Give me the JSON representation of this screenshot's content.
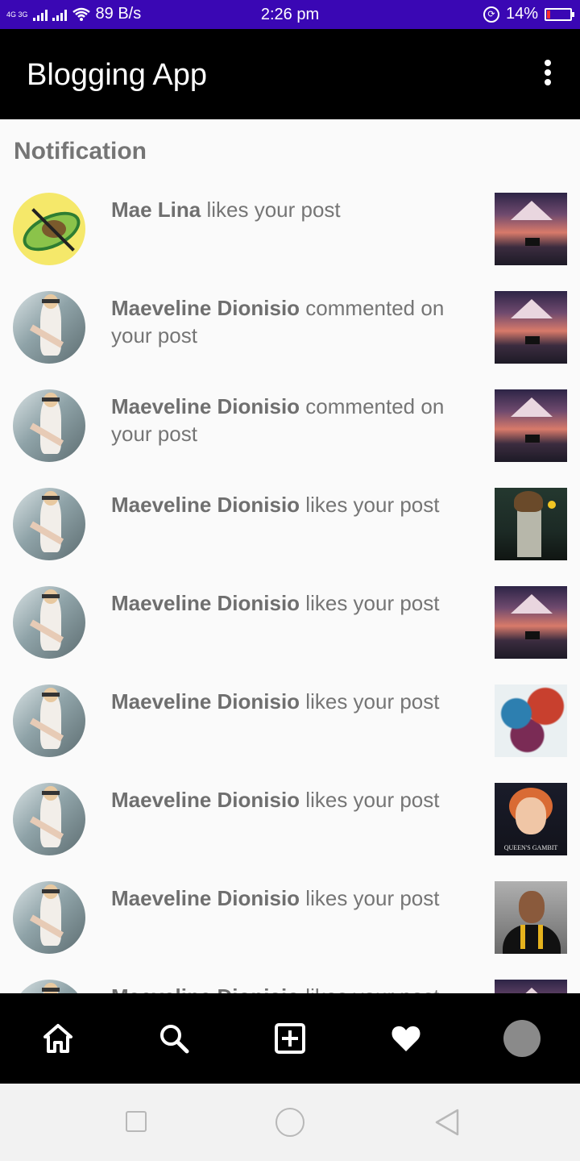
{
  "status_bar": {
    "network": "4G 3G",
    "speed": "89 B/s",
    "time": "2:26 pm",
    "battery_percent": "14%",
    "battery_level": 0.14
  },
  "app_bar": {
    "title": "Blogging App",
    "menu_icon": "more-vert-icon"
  },
  "section_title": "Notification",
  "notifications": [
    {
      "user": "Mae Lina",
      "action": " likes your post",
      "avatar": "avocado",
      "thumb": "mountain"
    },
    {
      "user": "Maeveline Dionisio",
      "action": " commented on your post",
      "avatar": "woman",
      "thumb": "mountain"
    },
    {
      "user": "Maeveline Dionisio",
      "action": " commented on your post",
      "avatar": "woman",
      "thumb": "mountain"
    },
    {
      "user": "Maeveline Dionisio",
      "action": " likes your post",
      "avatar": "woman",
      "thumb": "knight"
    },
    {
      "user": "Maeveline Dionisio",
      "action": " likes your post",
      "avatar": "woman",
      "thumb": "mountain"
    },
    {
      "user": "Maeveline Dionisio",
      "action": " likes your post",
      "avatar": "woman",
      "thumb": "dragon"
    },
    {
      "user": "Maeveline Dionisio",
      "action": " likes your post",
      "avatar": "woman",
      "thumb": "queen",
      "thumb_caption": "QUEEN'S GAMBIT"
    },
    {
      "user": "Maeveline Dionisio",
      "action": " likes your post",
      "avatar": "woman",
      "thumb": "graduate"
    },
    {
      "user": "Maeveline Dionisio",
      "action": " likes your post",
      "avatar": "woman",
      "thumb": "mountain"
    }
  ],
  "bottom_nav": {
    "items": [
      "home-icon",
      "search-icon",
      "add-box-icon",
      "heart-icon",
      "profile-avatar"
    ]
  },
  "system_nav": {
    "items": [
      "recents-square-icon",
      "home-circle-icon",
      "back-triangle-icon"
    ]
  },
  "colors": {
    "status_bar": "#3a07b4",
    "app_bar": "#000000",
    "background": "#fafafa",
    "text": "#757575",
    "battery_low": "#ff2d2d"
  }
}
